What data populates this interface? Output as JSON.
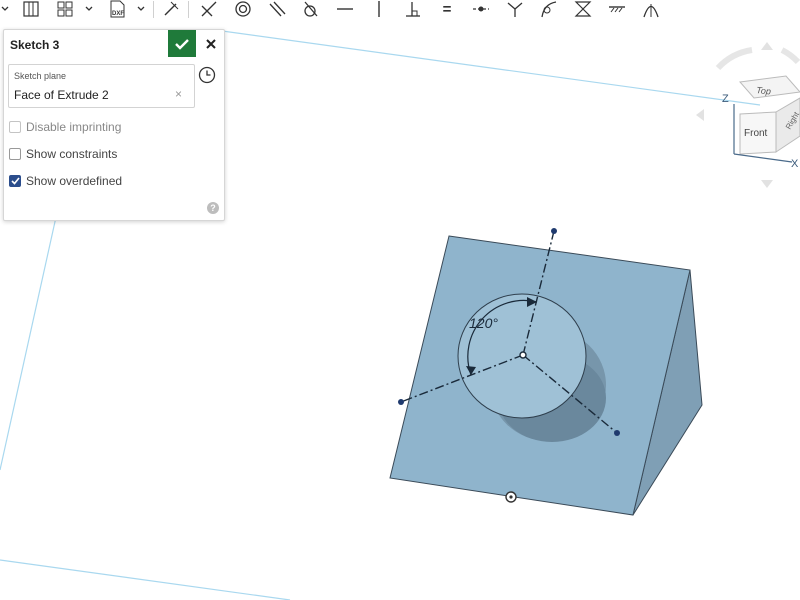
{
  "panel": {
    "title": "Sketch 3",
    "sketch_plane_label": "Sketch plane",
    "sketch_plane_value": "Face of Extrude 2",
    "clear_symbol": "×",
    "options": [
      {
        "label": "Disable imprinting",
        "checked": false,
        "disabled": true
      },
      {
        "label": "Show constraints",
        "checked": false,
        "disabled": false
      },
      {
        "label": "Show overdefined",
        "checked": true,
        "disabled": false
      }
    ],
    "help_symbol": "?"
  },
  "toolbar": {
    "icons": [
      "chevron-down-icon",
      "hole-table-icon",
      "grid-pattern-icon",
      "chevron-down-icon",
      "dxf-import-icon",
      "chevron-down-icon",
      "dimension-tool-icon",
      "trim-icon",
      "offset-circle-icon",
      "parallel-icon",
      "tangent-icon",
      "horizontal-icon",
      "vertical-icon",
      "perpendicular-icon",
      "equal-icon",
      "midpoint-icon",
      "symmetric-icon",
      "curvature-icon",
      "mirror-icon",
      "fix-icon",
      "pierce-icon"
    ],
    "dxf_label": "DXF",
    "equal_symbol": "="
  },
  "viewcube": {
    "top_label": "Top",
    "front_label": "Front",
    "right_label": "Right",
    "z_axis": "Z",
    "x_axis": "X"
  },
  "sketch": {
    "angle_dimension": "120°"
  },
  "colors": {
    "accent_ok": "#1f7a3a",
    "part_face": "#8fb4cc",
    "sketch_lines": "#1a2a3a",
    "plane_outline": "#a9d8ef",
    "checkbox_checked": "#2b4d8c"
  }
}
